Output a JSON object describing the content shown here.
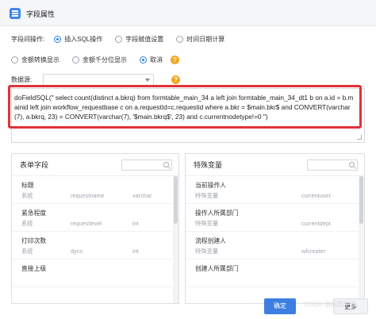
{
  "window": {
    "title": "字段属性"
  },
  "operations": {
    "label": "字段间操作:",
    "options": [
      "插入SQL操作",
      "字段赋值设置",
      "时间日期计算"
    ],
    "selected": 0
  },
  "number_format": {
    "options": [
      "金额转换显示",
      "金额千分位显示",
      "取消"
    ],
    "selected": 2
  },
  "datasource": {
    "label": "数据源:",
    "value": ""
  },
  "sql": {
    "text": "doFieldSQL(\" select count(distinct a.bkrq) from formtable_main_34 a left join formtable_main_34_dt1 b on a.id = b.mainid left join workflow_requestbase c on a.requestId=c.requestid where a.bkr = $main.bkr$ and CONVERT(varchar(7), a.bkrq, 23) = CONVERT(varchar(7), '$main.bkrq$', 23) and c.currentnodetype!=0 \")"
  },
  "form_fields": {
    "title": "表单字段",
    "items": [
      {
        "name": "标题",
        "type": "系统",
        "field": "requestname",
        "dtype": "varchar"
      },
      {
        "name": "紧急程度",
        "type": "系统",
        "field": "requestlevel",
        "dtype": "int"
      },
      {
        "name": "打印次数",
        "type": "系统",
        "field": "dycs",
        "dtype": "int"
      },
      {
        "name": "直接上级",
        "type": "",
        "field": "",
        "dtype": ""
      }
    ]
  },
  "special_vars": {
    "title": "特殊变量",
    "items": [
      {
        "name": "当前操作人",
        "type": "特殊变量",
        "field": "currentuser"
      },
      {
        "name": "操作人所属部门",
        "type": "特殊变量",
        "field": "currentdept"
      },
      {
        "name": "流程创建人",
        "type": "特殊变量",
        "field": "wfcreater"
      },
      {
        "name": "创建人所属部门",
        "type": "",
        "field": ""
      }
    ]
  },
  "buttons": {
    "ok": "确定",
    "more": "更多"
  },
  "watermark": "CSDN @雨落星辰"
}
